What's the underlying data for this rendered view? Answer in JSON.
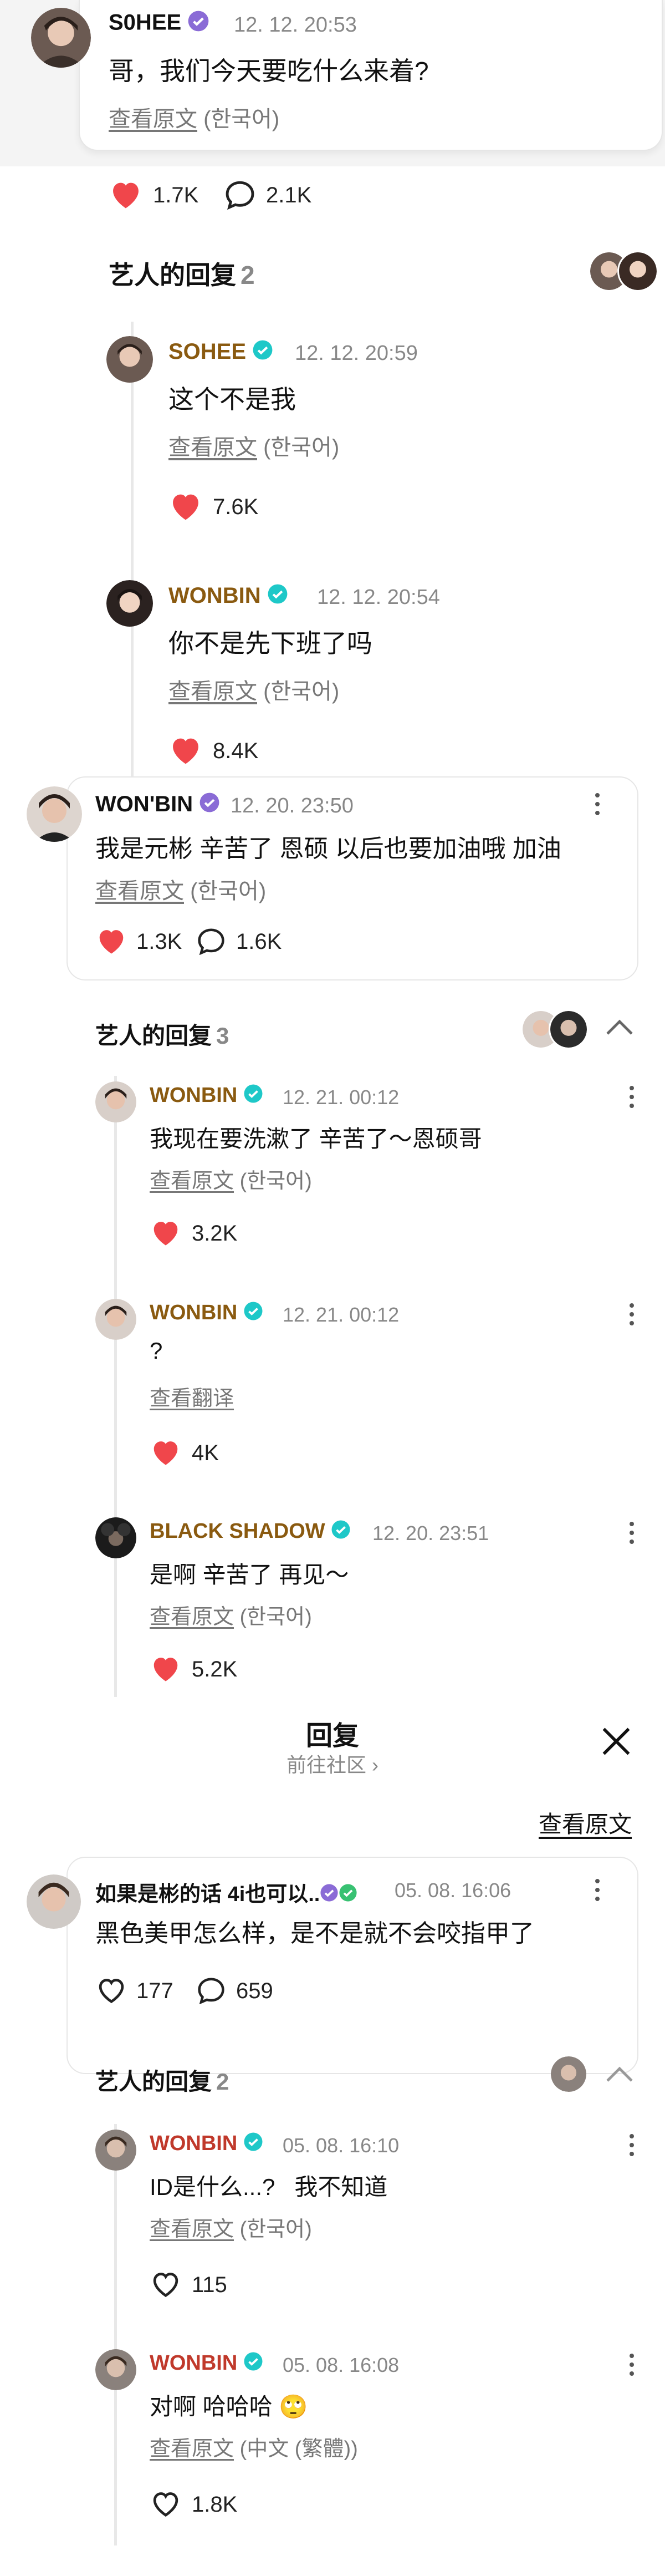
{
  "c1": {
    "name": "S0HEE",
    "time": "12. 12. 20:53",
    "text": "哥，我们今天要吃什么来着?",
    "view_link": "查看原文",
    "view_lang": "(한국어)",
    "likes": "1.7K",
    "replies": "2.1K",
    "artist_replies_label": "艺人的回复",
    "artist_replies_count": "2",
    "r1": {
      "name": "SOHEE",
      "time": "12. 12. 20:59",
      "text": "这个不是我",
      "view_link": "查看原文",
      "view_lang": "(한국어)",
      "likes": "7.6K"
    },
    "r2": {
      "name": "WONBIN",
      "time": "12. 12. 20:54",
      "text": "你不是先下班了吗",
      "view_link": "查看原文",
      "view_lang": "(한국어)",
      "likes": "8.4K"
    }
  },
  "c2": {
    "name": "WON'BIN",
    "time": "12. 20. 23:50",
    "text": "我是元彬 辛苦了 恩硕 以后也要加油哦 加油",
    "view_link": "查看原文",
    "view_lang": "(한국어)",
    "likes": "1.3K",
    "replies": "1.6K",
    "artist_replies_label": "艺人的回复",
    "artist_replies_count": "3",
    "r1": {
      "name": "WONBIN",
      "time": "12. 21. 00:12",
      "text": "我现在要洗漱了 辛苦了～恩硕哥",
      "view_link": "查看原文",
      "view_lang": "(한국어)",
      "likes": "3.2K"
    },
    "r2": {
      "name": "WONBIN",
      "time": "12. 21. 00:12",
      "text": "?",
      "view_link": "查看翻译",
      "likes": "4K"
    },
    "r3": {
      "name": "BLACK SHADOW",
      "time": "12. 20. 23:51",
      "text": "是啊 辛苦了 再见～",
      "view_link": "查看原文",
      "view_lang": "(한국어)",
      "likes": "5.2K"
    }
  },
  "header": {
    "title": "回复",
    "subtitle": "前往社区 ›",
    "view_original": "查看原文"
  },
  "c3": {
    "name": "如果是彬的话 4i也可以..",
    "time": "05. 08. 16:06",
    "text": "黑色美甲怎么样，是不是就不会咬指甲了",
    "likes": "177",
    "replies": "659",
    "artist_replies_label": "艺人的回复",
    "artist_replies_count": "2",
    "r1": {
      "name": "WONBIN",
      "time": "05. 08. 16:10",
      "text": "ID是什么...?   我不知道",
      "view_link": "查看原文",
      "view_lang": "(한국어)",
      "likes": "115"
    },
    "r2": {
      "name": "WONBIN",
      "time": "05. 08. 16:08",
      "text": "对啊 哈哈哈 🙄",
      "view_link": "查看原文",
      "view_lang": "(中文 (繁體))",
      "likes": "1.8K"
    }
  },
  "colors": {
    "artist_name": "#8a5a10",
    "verified_teal": "#1ec8c8",
    "verified_purple": "#8a6bd6",
    "heart_red": "#f0464b",
    "muted": "#888888"
  }
}
